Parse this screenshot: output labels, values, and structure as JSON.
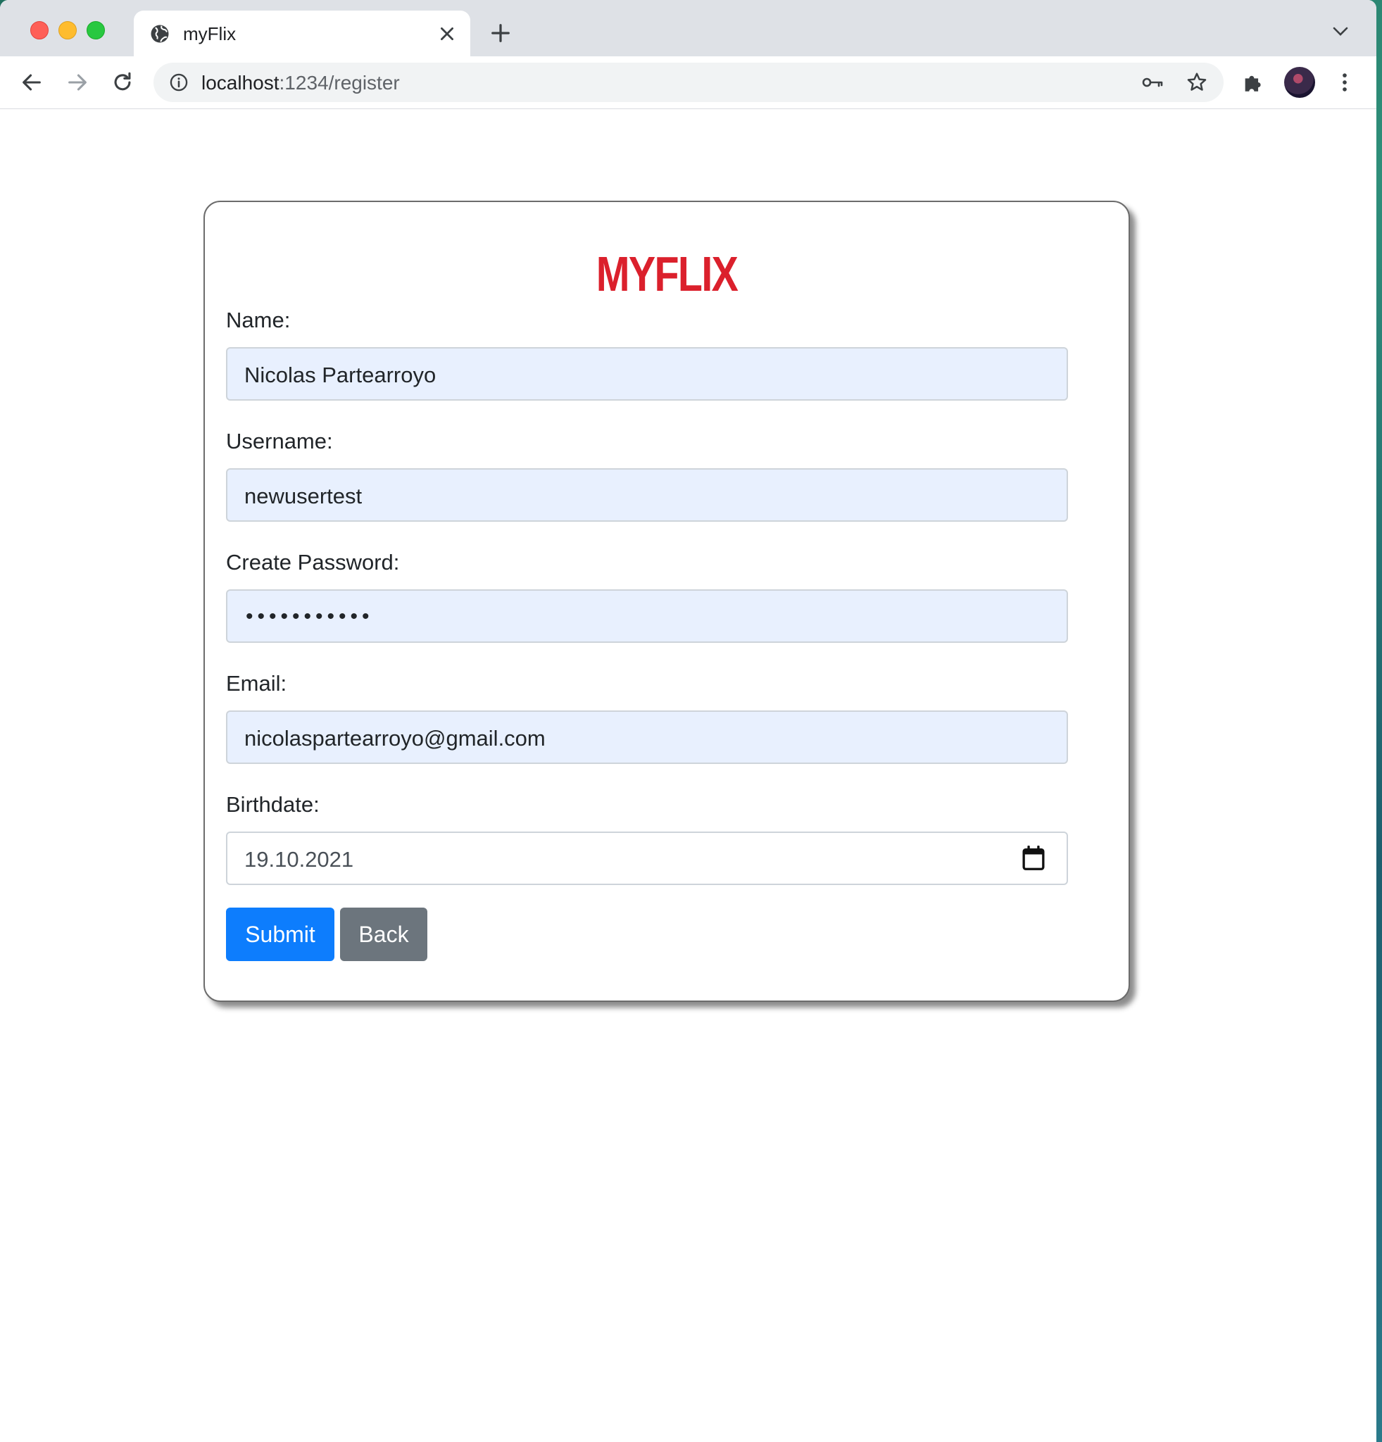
{
  "browser": {
    "tab_title": "myFlix",
    "url_host": "localhost",
    "url_path": ":1234/register"
  },
  "form": {
    "logo": "MYFLIX",
    "name_label": "Name:",
    "name_value": "Nicolas Partearroyo",
    "username_label": "Username:",
    "username_value": "newusertest",
    "password_label": "Create Password:",
    "password_mask": "•••••••••••",
    "email_label": "Email:",
    "email_value": "nicolaspartearroyo@gmail.com",
    "birthdate_label": "Birthdate:",
    "birthdate_value": "19.10.2021",
    "submit_label": "Submit",
    "back_label": "Back"
  },
  "colors": {
    "logo_red": "#db202c",
    "primary": "#0d7dfd",
    "secondary": "#6c757d",
    "autofill_bg": "#e8f0fe"
  },
  "icons": [
    "globe-icon",
    "close-icon",
    "plus-icon",
    "chevron-down-icon",
    "back-arrow-icon",
    "forward-arrow-icon",
    "reload-icon",
    "info-icon",
    "key-icon",
    "star-icon",
    "puzzle-icon",
    "kebab-menu-icon",
    "calendar-icon"
  ]
}
